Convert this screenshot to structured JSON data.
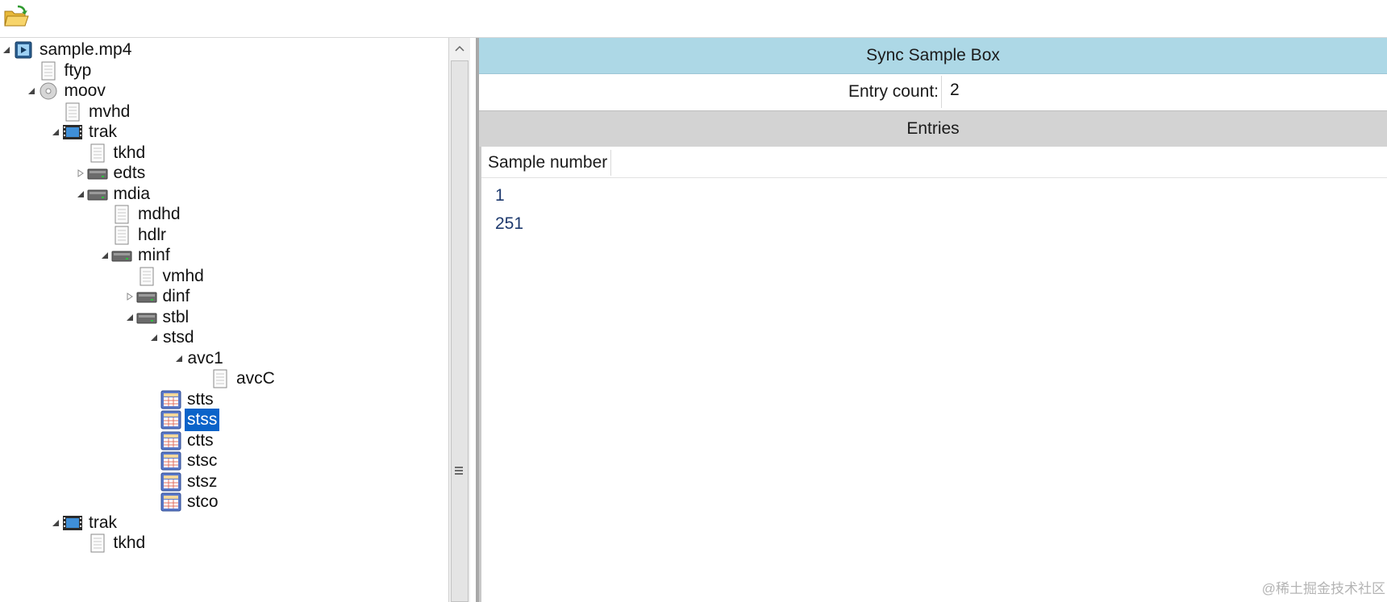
{
  "toolbar": {
    "open_icon": "folder-open-icon"
  },
  "tree": {
    "items": [
      {
        "label": "sample.mp4",
        "level": 0,
        "toggle": "expanded",
        "icon": "video-file-icon",
        "selected": false
      },
      {
        "label": "ftyp",
        "level": 1,
        "toggle": "none",
        "icon": "document-icon",
        "selected": false
      },
      {
        "label": "moov",
        "level": 1,
        "toggle": "expanded",
        "icon": "disc-icon",
        "selected": false
      },
      {
        "label": "mvhd",
        "level": 2,
        "toggle": "none",
        "icon": "document-icon",
        "selected": false
      },
      {
        "label": "trak",
        "level": 2,
        "toggle": "expanded",
        "icon": "film-icon",
        "selected": false
      },
      {
        "label": "tkhd",
        "level": 3,
        "toggle": "none",
        "icon": "document-icon",
        "selected": false
      },
      {
        "label": "edts",
        "level": 3,
        "toggle": "collapsed",
        "icon": "drive-icon",
        "selected": false
      },
      {
        "label": "mdia",
        "level": 3,
        "toggle": "expanded",
        "icon": "drive-icon",
        "selected": false
      },
      {
        "label": "mdhd",
        "level": 4,
        "toggle": "none",
        "icon": "document-icon",
        "selected": false
      },
      {
        "label": "hdlr",
        "level": 4,
        "toggle": "none",
        "icon": "document-icon",
        "selected": false
      },
      {
        "label": "minf",
        "level": 4,
        "toggle": "expanded",
        "icon": "drive-icon",
        "selected": false
      },
      {
        "label": "vmhd",
        "level": 5,
        "toggle": "none",
        "icon": "document-icon",
        "selected": false
      },
      {
        "label": "dinf",
        "level": 5,
        "toggle": "collapsed",
        "icon": "drive-icon",
        "selected": false
      },
      {
        "label": "stbl",
        "level": 5,
        "toggle": "expanded",
        "icon": "drive-icon",
        "selected": false
      },
      {
        "label": "stsd",
        "level": 6,
        "toggle": "expanded",
        "icon": "none",
        "selected": false
      },
      {
        "label": "avc1",
        "level": 7,
        "toggle": "expanded",
        "icon": "none",
        "selected": false
      },
      {
        "label": "avcC",
        "level": 8,
        "toggle": "none",
        "icon": "document-icon",
        "selected": false
      },
      {
        "label": "stts",
        "level": 6,
        "toggle": "none",
        "icon": "table-icon",
        "selected": false
      },
      {
        "label": "stss",
        "level": 6,
        "toggle": "none",
        "icon": "table-icon",
        "selected": true
      },
      {
        "label": "ctts",
        "level": 6,
        "toggle": "none",
        "icon": "table-icon",
        "selected": false
      },
      {
        "label": "stsc",
        "level": 6,
        "toggle": "none",
        "icon": "table-icon",
        "selected": false
      },
      {
        "label": "stsz",
        "level": 6,
        "toggle": "none",
        "icon": "table-icon",
        "selected": false
      },
      {
        "label": "stco",
        "level": 6,
        "toggle": "none",
        "icon": "table-icon",
        "selected": false
      },
      {
        "label": "trak",
        "level": 2,
        "toggle": "expanded",
        "icon": "film-icon",
        "selected": false
      },
      {
        "label": "tkhd",
        "level": 3,
        "toggle": "none",
        "icon": "document-icon",
        "selected": false
      }
    ]
  },
  "detail": {
    "title": "Sync Sample Box",
    "entry_count_label": "Entry count:",
    "entry_count_value": "2",
    "entries_title": "Entries",
    "column_header": "Sample number",
    "rows": [
      "1",
      "251"
    ]
  },
  "watermark": "@稀土掘金技术社区"
}
